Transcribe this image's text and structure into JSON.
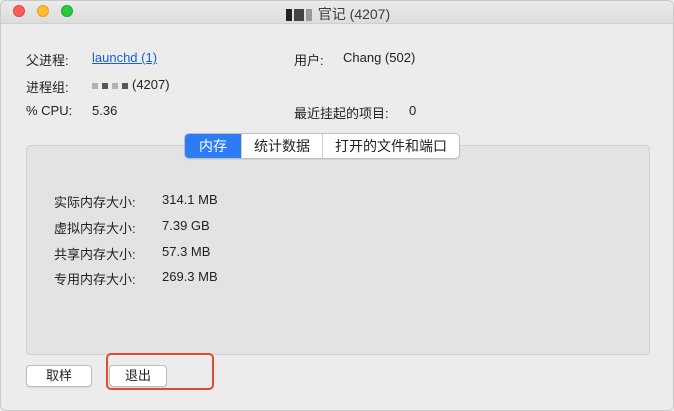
{
  "window": {
    "title_suffix": "官记 (4207)",
    "colors": {
      "close": "#fe5f57",
      "minimize": "#febc2e",
      "maximize": "#28c840"
    }
  },
  "info": {
    "parent_label": "父进程:",
    "parent_value": "launchd (1)",
    "group_label": "进程组:",
    "group_value": "(4207)",
    "cpu_label": "% CPU:",
    "cpu_value": "5.36",
    "user_label": "用户:",
    "user_value": "Chang (502)",
    "recent_label": "最近挂起的项目:",
    "recent_value": "0"
  },
  "tabs": [
    {
      "label": "内存",
      "active": true
    },
    {
      "label": "统计数据",
      "active": false
    },
    {
      "label": "打开的文件和端口",
      "active": false
    }
  ],
  "memory": [
    {
      "label": "实际内存大小:",
      "value": "314.1 MB"
    },
    {
      "label": "虚拟内存大小:",
      "value": "7.39 GB"
    },
    {
      "label": "共享内存大小:",
      "value": "57.3 MB"
    },
    {
      "label": "专用内存大小:",
      "value": "269.3 MB"
    }
  ],
  "buttons": {
    "sample": "取样",
    "quit": "退出"
  },
  "accent_color": "#2d7cf6",
  "highlight_color": "#e24a2b"
}
